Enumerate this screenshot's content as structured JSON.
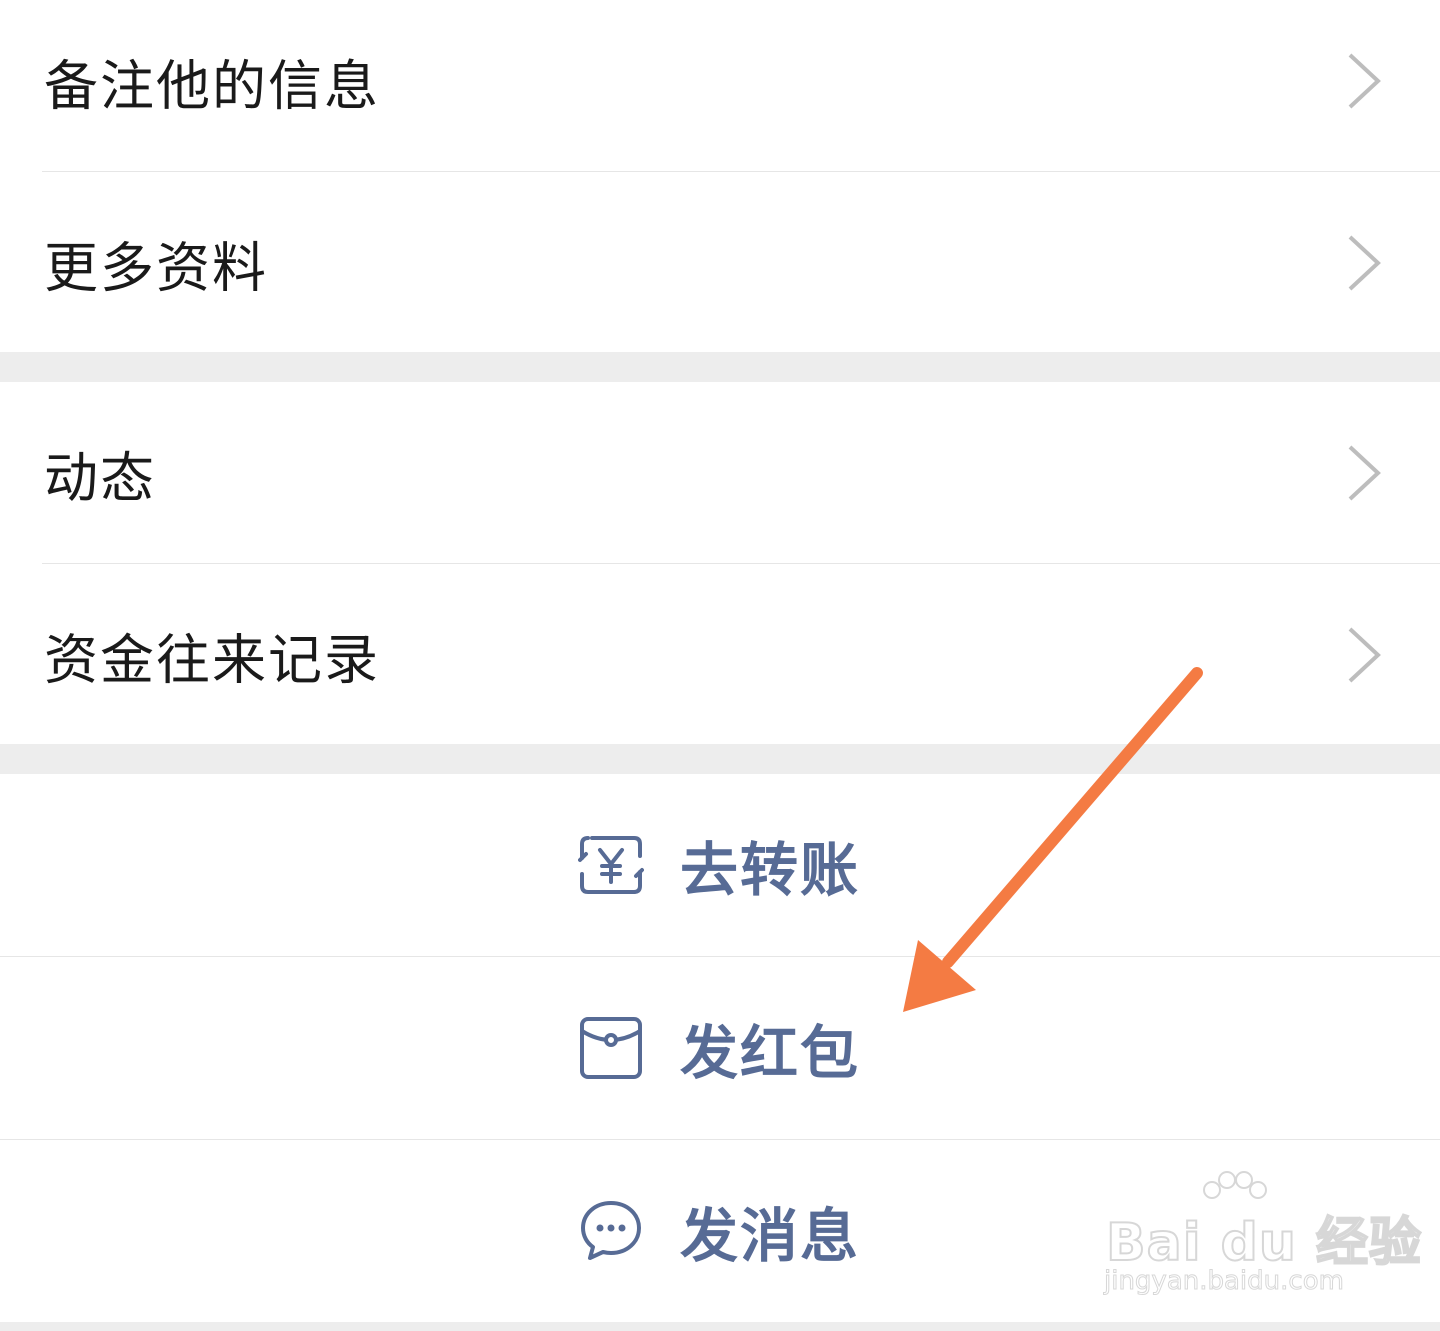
{
  "profile_rows": [
    {
      "label": "备注他的信息"
    },
    {
      "label": "更多资料"
    }
  ],
  "feed_rows": [
    {
      "label": "动态"
    },
    {
      "label": "资金往来记录"
    }
  ],
  "actions": [
    {
      "label": "去转账",
      "icon": "transfer-yuan-icon"
    },
    {
      "label": "发红包",
      "icon": "red-packet-icon"
    },
    {
      "label": "发消息",
      "icon": "chat-bubble-icon"
    }
  ],
  "watermark": {
    "brand": "Bai du 经验",
    "url": "jingyan.baidu.com"
  },
  "colors": {
    "action_text": "#576b95",
    "annotation_arrow": "#f47b43",
    "chevron": "#bdbdbd",
    "background": "#ededed"
  }
}
